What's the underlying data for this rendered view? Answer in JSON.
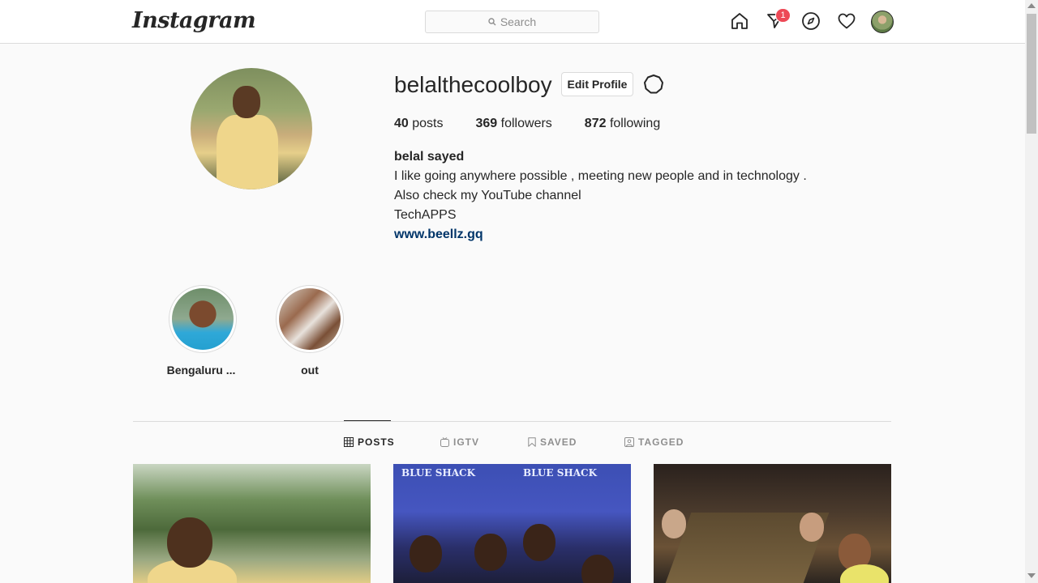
{
  "nav": {
    "logo": "Instagram",
    "search_placeholder": "Search",
    "badge_count": "1",
    "icons": [
      "home-icon",
      "direct-icon",
      "explore-icon",
      "activity-heart-icon",
      "profile-avatar"
    ]
  },
  "profile": {
    "username": "belalthecoolboy",
    "edit_label": "Edit Profile",
    "stats": {
      "posts_count": "40",
      "posts_label": "posts",
      "followers_count": "369",
      "followers_label": "followers",
      "following_count": "872",
      "following_label": "following"
    },
    "full_name": "belal sayed",
    "bio": [
      "I like going anywhere possible , meeting new people and in technology .",
      "Also check my YouTube channel",
      "TechAPPS"
    ],
    "website": "www.beellz.gq"
  },
  "highlights": [
    {
      "label": "Bengaluru ..."
    },
    {
      "label": "out"
    }
  ],
  "tabs": [
    {
      "label": "POSTS",
      "icon": "grid-icon",
      "active": true
    },
    {
      "label": "IGTV",
      "icon": "igtv-icon",
      "active": false
    },
    {
      "label": "SAVED",
      "icon": "bookmark-icon",
      "active": false
    },
    {
      "label": "TAGGED",
      "icon": "tag-icon",
      "active": false
    }
  ],
  "posts": [
    {
      "alt": "man in yellow shirt in forest"
    },
    {
      "alt": "group photo at Blue Shack",
      "sign_text": "BLUE SHACK"
    },
    {
      "alt": "friends at dinner table"
    }
  ],
  "colors": {
    "link": "#003569",
    "badge": "#ed4956",
    "text": "#262626",
    "muted": "#8e8e8e",
    "border": "#dbdbdb"
  }
}
